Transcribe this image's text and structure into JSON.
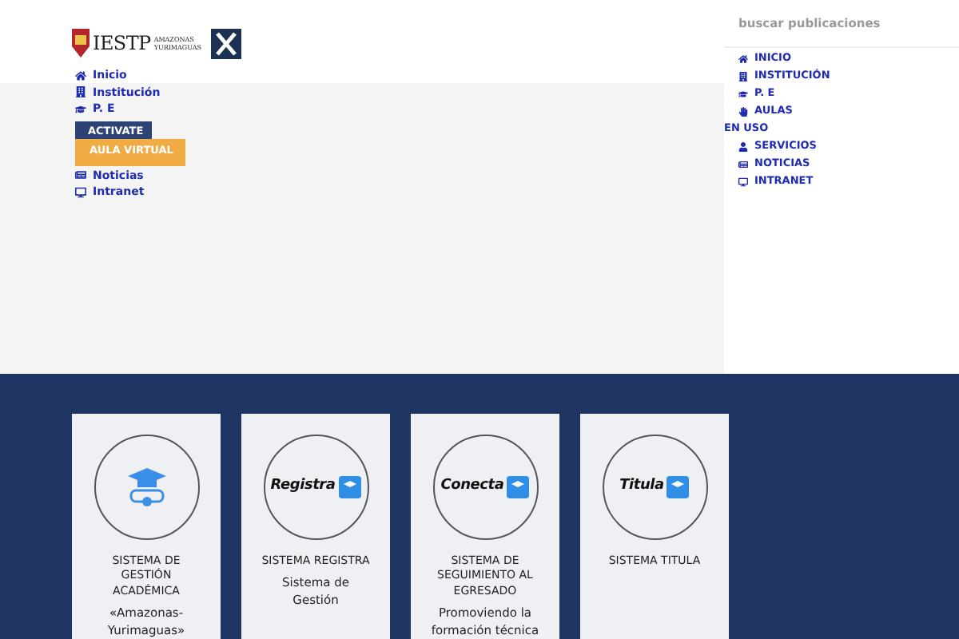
{
  "header": {
    "logo_text": "IESTP",
    "logo_subtitle": "AMAZONAS YURIMAGUAS"
  },
  "nav": [
    {
      "label": "Inicio",
      "kind": "home"
    },
    {
      "label": "Institución",
      "kind": "building"
    },
    {
      "label": "P. E",
      "kind": "cap"
    }
  ],
  "nav_buttons": [
    {
      "label": "ACTIVATE",
      "kind": "dark"
    },
    {
      "label": "AULA VIRTUAL",
      "kind": "orange"
    }
  ],
  "nav_bottom": [
    {
      "label": "Noticias",
      "kind": "news"
    },
    {
      "label": "Intranet",
      "kind": "desktop"
    }
  ],
  "search": {
    "placeholder": "buscar publicaciones"
  },
  "side_menu": [
    {
      "label": "INICIO",
      "kind": "home"
    },
    {
      "label": "INSTITUCIÓN",
      "kind": "building"
    },
    {
      "label": "P. E",
      "kind": "cap"
    },
    {
      "label": "AULAS",
      "kind": "hand"
    }
  ],
  "side_heading": "EN USO",
  "side_menu_2": [
    {
      "label": "SERVICIOS",
      "kind": "person"
    },
    {
      "label": "NOTICIAS",
      "kind": "news"
    },
    {
      "label": "INTRANET",
      "kind": "desktop"
    }
  ],
  "cards": [
    {
      "kind": "cap",
      "title": "SISTEMA DE GESTIÓN ACADÉMICA",
      "text": "«Amazonas-Yurimaguas»"
    },
    {
      "kind": "logo",
      "logo": "Registra",
      "title": "SISTEMA REGISTRA",
      "text": "Sistema de Gestión"
    },
    {
      "kind": "logo",
      "logo": "Conecta",
      "title": "SISTEMA DE SEGUIMIENTO AL EGRESADO",
      "text": "Promoviendo la formación técnica"
    },
    {
      "kind": "logo",
      "logo": "Titula",
      "title": "SISTEMA TITULA"
    }
  ]
}
